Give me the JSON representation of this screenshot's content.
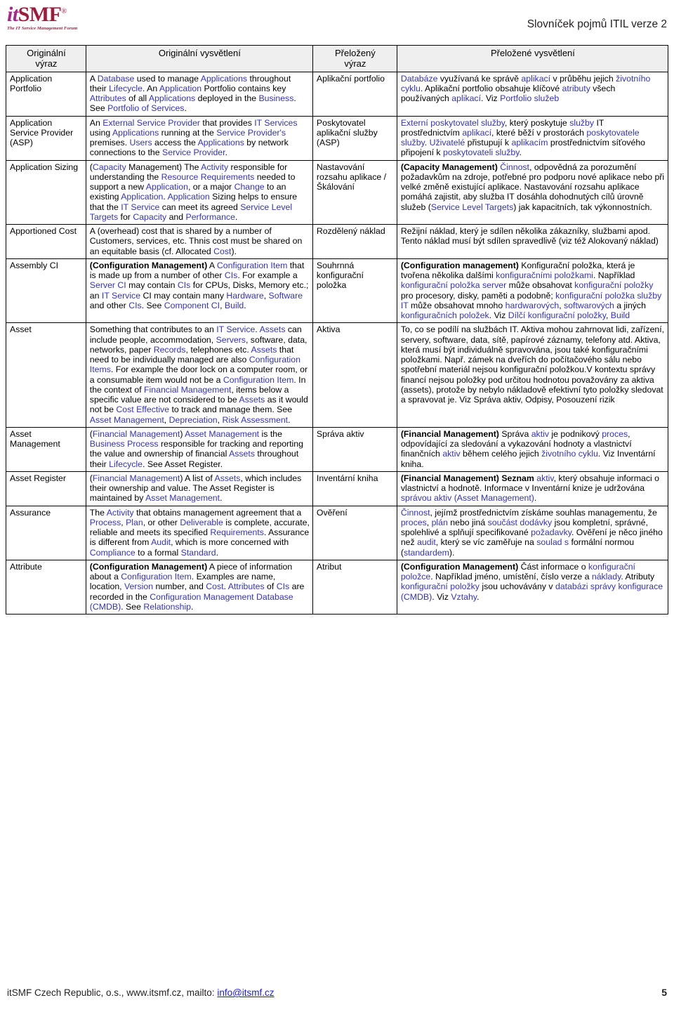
{
  "header": {
    "logo_it": "it",
    "logo_smf": "SMF",
    "logo_reg": "®",
    "logo_tagline": "The IT Service Management Forum",
    "doc_title": "Slovníček pojmů ITIL verze 2"
  },
  "table": {
    "columns": [
      {
        "line1": "Originální",
        "line2": "výraz"
      },
      {
        "line1": "Originální vysvětlení",
        "line2": ""
      },
      {
        "line1": "Přeložený",
        "line2": "výraz"
      },
      {
        "line1": "Přeložené vysvětlení",
        "line2": ""
      }
    ],
    "rows": [
      {
        "term_en": "Application Portfolio",
        "desc_en": "A Database used to manage Applications throughout their Lifecycle. An Application Portfolio contains key Attributes of all Applications deployed in the Business. See Portfolio of Services.",
        "term_cs": "Aplikační portfolio",
        "desc_cs": "Databáze využívaná ke správě aplikací v průběhu jejich životního cyklu. Aplikační portfolio obsahuje klíčové atributy všech používaných aplikací. Viz Portfolio služeb"
      },
      {
        "term_en": "Application Service Provider (ASP)",
        "desc_en": "An External Service Provider that provides IT Services using Applications running at the Service Provider's premises. Users access the Applications by network connections to the Service Provider.",
        "term_cs": "Poskytovatel aplikační služby (ASP)",
        "desc_cs": "Externí poskytovatel služby, který poskytuje služby IT prostřednictvím aplikací, které běží v prostorách poskytovatele služby. Uživatelé přistupují k aplikacím prostřednictvím síťového připojení k poskytovateli služby."
      },
      {
        "term_en": "Application Sizing",
        "desc_en": "(Capacity Management) The Activity responsible for understanding the Resource Requirements needed to support a new Application, or a major Change to an existing Application. Application Sizing helps to ensure that the IT Service can meet its agreed Service Level Targets for Capacity and Performance.",
        "term_cs": "Nastavování rozsahu aplikace / Škálování",
        "desc_cs": "(Capacity Management) Činnost, odpovědná za porozumění požadavkům na zdroje, potřebné pro podporu nové aplikace nebo při velké změně existující aplikace. Nastavování rozsahu aplikace pomáhá zajistit, aby služba IT dosáhla dohodnutých cílů úrovně služeb (Service Level Targets) jak kapacitních, tak výkonnostních."
      },
      {
        "term_en": "Apportioned Cost",
        "desc_en": "A (overhead) cost that is shared by a number of Customers, services, etc. Thnis cost must be shared on an equitable basis (cf. Allocated Cost).",
        "term_cs": "Rozdělený náklad",
        "desc_cs": "Režijní náklad, který je sdílen několika zákazníky, službami apod. Tento náklad musí být sdílen spravedlivě (viz též Alokovaný náklad)"
      },
      {
        "term_en": "Assembly CI",
        "desc_en": "(Configuration Management) A Configuration Item that is made up from a number of other CIs. For example a Server CI may contain CIs for CPUs, Disks, Memory etc.; an IT Service CI may contain many Hardware, Software and other CIs. See Component CI, Build.",
        "term_cs": "Souhrnná konfigurační položka",
        "desc_cs": "(Configuration management) Konfigurační položka, která je tvořena několika dalšími konfiguračními položkami. Například konfigurační položka server může obsahovat konfigurační položky pro procesory, disky, paměti a podobně; konfigurační položka služby IT může obsahovat mnoho hardwarových, softwarových a jiných konfiguračních položek. Viz Dílčí konfigurační položky, Build"
      },
      {
        "term_en": "Asset",
        "desc_en": "Something that contributes to an IT Service. Assets can include people, accommodation, Servers, software, data, networks, paper Records, telephones etc. Assets that need to be individually managed are also Configuration Items. For example the door lock on a computer room, or a consumable item would not be a Configuration Item. In the context of Financial Management, items below a specific value are not considered to be Assets as it would not be Cost Effective to track and manage them. See Asset Management, Depreciation, Risk Assessment.",
        "term_cs": "Aktiva",
        "desc_cs": "To, co se podílí na službách IT. Aktiva mohou zahrnovat lidi, zařízení, servery, software, data, sítě, papírové záznamy, telefony atd. Aktiva, která musí být individuálně spravována, jsou také konfiguračními položkami. Např. zámek na dveřích do počítačového sálu nebo spotřební materiál nejsou konfigurační položkou.V kontextu správy financí nejsou položky pod určitou hodnotou považovány za aktiva (assets), protože by nebylo nákladově efektivní tyto položky sledovat a spravovat je. Viz Správa aktiv, Odpisy, Posouzení rizik"
      },
      {
        "term_en": "Asset Management",
        "desc_en": "(Financial Management) Asset Management is the Business Process responsible for tracking and reporting the value and ownership of financial Assets throughout their Lifecycle. See Asset Register.",
        "term_cs": "Správa aktiv",
        "desc_cs": "(Financial Management) Správa aktiv je podnikový proces, odpovídající za sledování a vykazování hodnoty a vlastnictví finančních aktiv během celého jejich životního cyklu. Viz Inventární kniha."
      },
      {
        "term_en": "Asset Register",
        "desc_en": "(Financial Management) A list of Assets, which includes their ownership and value. The Asset Register is maintained by Asset Management.",
        "term_cs": "Inventární kniha",
        "desc_cs": "(Financial Management) Seznam aktiv, který obsahuje informaci o vlastnictví a hodnotě. Informace v Inventární knize je udržována správou aktiv (Asset Management)."
      },
      {
        "term_en": "Assurance",
        "desc_en": "The Activity that obtains management agreement that a Process, Plan, or other Deliverable is complete, accurate, reliable and meets its specified Requirements. Assurance is different from Audit, which is more concerned with Compliance to a formal Standard.",
        "term_cs": "Ověření",
        "desc_cs": "Činnost, jejímž prostřednictvím získáme souhlas managementu, že proces, plán nebo jiná součást dodávky jsou kompletní, správné, spolehlivé a splňují specifikované požadavky. Ověření je něco jiného než audit, který se víc zaměřuje na soulad s formální normou (standardem)."
      },
      {
        "term_en": "Attribute",
        "desc_en": "(Configuration Management) A piece of information about a Configuration Item. Examples are name, location, Version number, and Cost. Attributes of CIs are recorded in the Configuration Management Database (CMDB). See Relationship.",
        "term_cs": "Atribut",
        "desc_cs": "(Configuration Management) Část informace o konfigurační položce. Například jméno, umístění, číslo verze a náklady. Atributy konfigurační položky jsou uchovávány v databázi správy konfigurace (CMDB). Viz Vztahy."
      }
    ]
  },
  "footer": {
    "text_before_mail": "itSMF Czech Republic, o.s., www.itsmf.cz, mailto: ",
    "mail": "info@itsmf.cz",
    "page_number": "5"
  },
  "colors": {
    "link_blue": "#3333BB",
    "logo_magenta": "#A6268C",
    "logo_crimson": "#9E1B3C",
    "header_fill": "#efefef",
    "mail_blue": "#1a1aee"
  }
}
